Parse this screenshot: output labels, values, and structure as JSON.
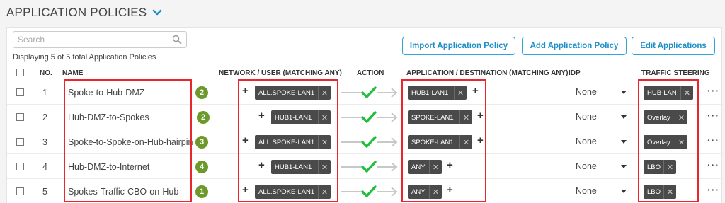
{
  "page": {
    "title": "APPLICATION POLICIES"
  },
  "search": {
    "placeholder": "Search"
  },
  "summary": "Displaying 5 of 5 total Application Policies",
  "buttons": {
    "import": "Import Application Policy",
    "add": "Add Application Policy",
    "edit": "Edit Applications"
  },
  "columns": {
    "no": "NO.",
    "name": "NAME",
    "network": "NETWORK / USER (MATCHING ANY)",
    "action": "ACTION",
    "application": "APPLICATION / DESTINATION (MATCHING ANY)",
    "idp": "IDP",
    "steering": "TRAFFIC STEERING"
  },
  "rows": [
    {
      "no": "1",
      "name": "Spoke-to-Hub-DMZ",
      "badge": "2",
      "network": "ALL.SPOKE-LAN1",
      "application": "HUB1-LAN1",
      "idp": "None",
      "steering": "HUB-LAN"
    },
    {
      "no": "2",
      "name": "Hub-DMZ-to-Spokes",
      "badge": "2",
      "network": "HUB1-LAN1",
      "application": "SPOKE-LAN1",
      "idp": "None",
      "steering": "Overlay"
    },
    {
      "no": "3",
      "name": "Spoke-to-Spoke-on-Hub-hairpin",
      "badge": "3",
      "network": "ALL.SPOKE-LAN1",
      "application": "SPOKE-LAN1",
      "idp": "None",
      "steering": "Overlay"
    },
    {
      "no": "4",
      "name": "Hub-DMZ-to-Internet",
      "badge": "4",
      "network": "HUB1-LAN1",
      "application": "ANY",
      "idp": "None",
      "steering": "LBO"
    },
    {
      "no": "5",
      "name": "Spokes-Traffic-CBO-on-Hub",
      "badge": "1",
      "network": "ALL.SPOKE-LAN1",
      "application": "ANY",
      "idp": "None",
      "steering": "LBO"
    }
  ],
  "colors": {
    "accent": "#1f8fc8",
    "badge": "#6c9a2a",
    "tag": "#4a4a4a",
    "check": "#1fbf3c",
    "highlight": "#e8262c"
  },
  "icons": {
    "title_chevron": "chevron-down-icon",
    "search": "search-icon",
    "action": "check-arrow-icon",
    "more": "more-options-icon"
  }
}
